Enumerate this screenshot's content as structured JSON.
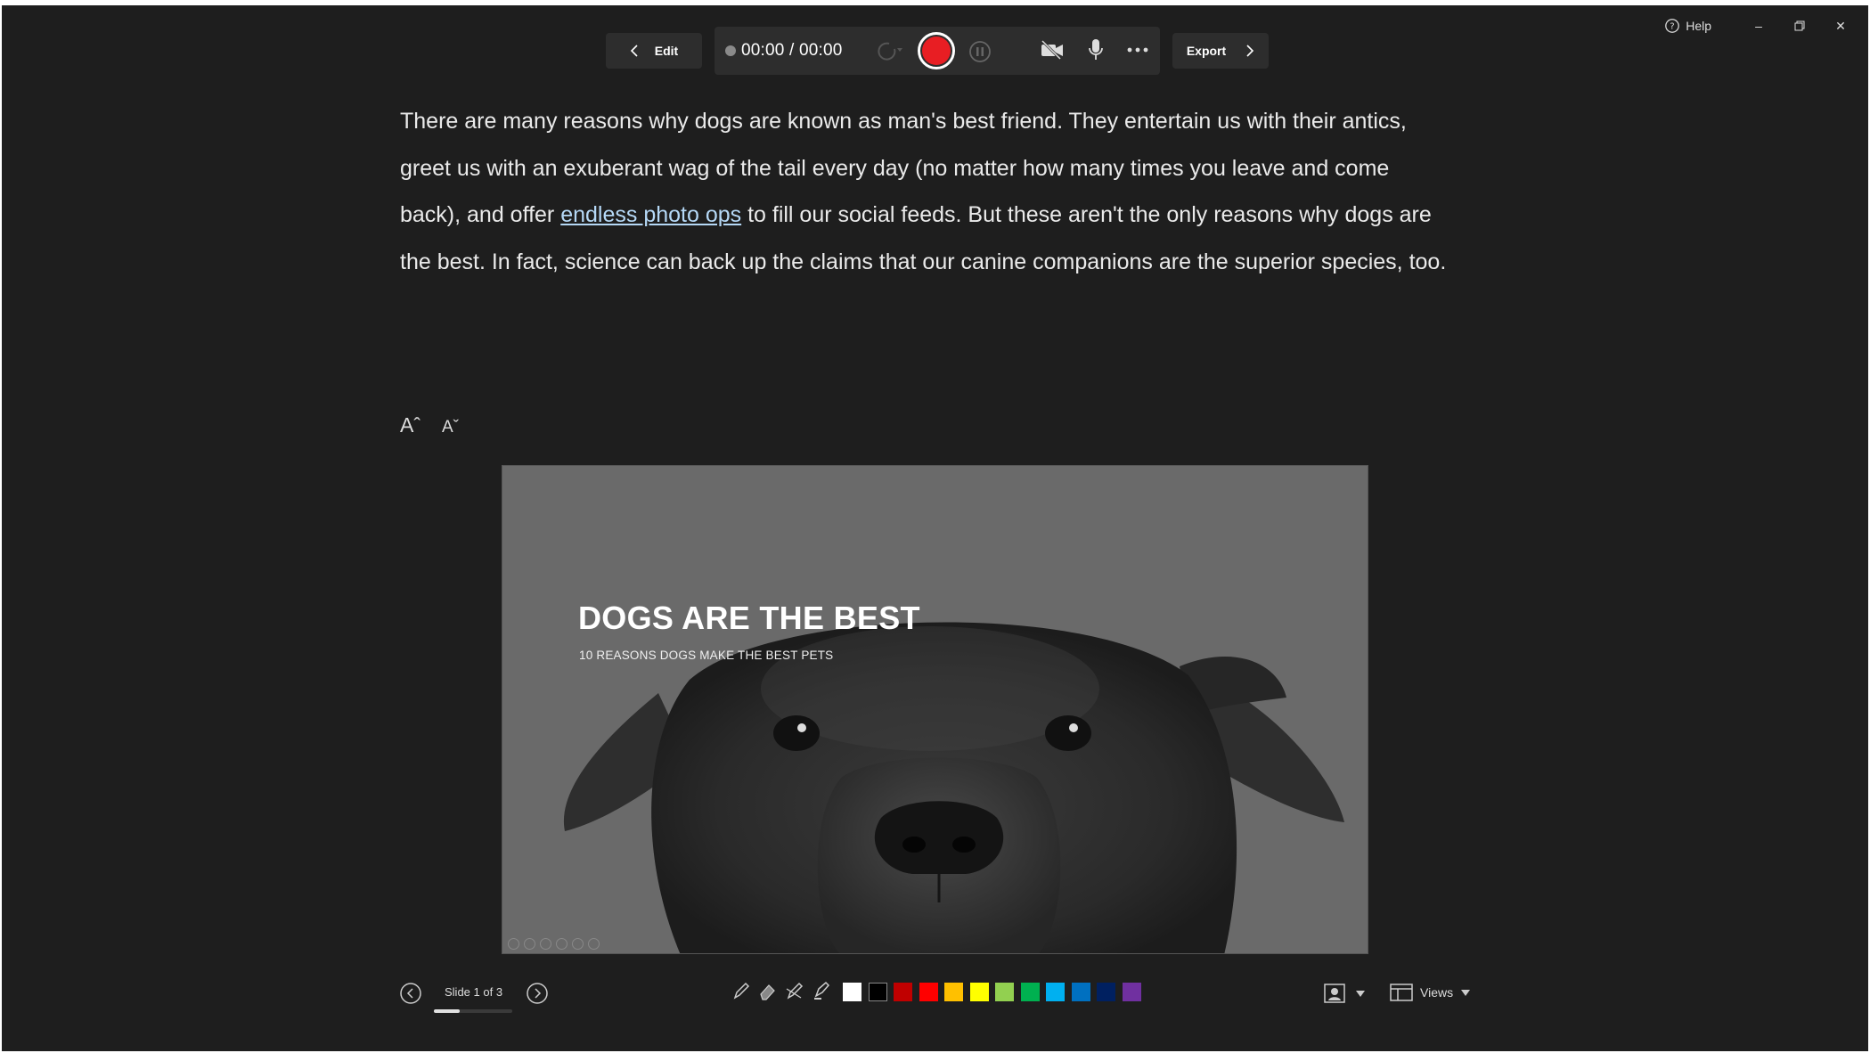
{
  "window": {
    "help_label": "Help",
    "minimize": "–",
    "restore": "🗗",
    "close": "✕"
  },
  "toolbar": {
    "edit_label": "Edit",
    "timer": "00:00 / 00:00",
    "export_label": "Export",
    "record_color": "#e81e23"
  },
  "notes": {
    "before_link": "There are many reasons why dogs are known as man's best friend. They entertain us with their antics, greet us with an exuberant wag of the tail every day (no matter how many times you leave and come back), and offer ",
    "link_text": "endless photo ops",
    "after_link": " to fill our social feeds. But these aren't the only reasons why dogs are the best. In fact, science can back up the claims that our canine companions are the superior species, too."
  },
  "font_controls": {
    "increase": "Aˆ",
    "decrease": "Aˇ"
  },
  "slide": {
    "title": "DOGS ARE THE BEST",
    "subtitle": "10 REASONS DOGS MAKE THE BEST PETS"
  },
  "navigation": {
    "slide_counter": "Slide 1 of 3",
    "progress_fraction": 0.333
  },
  "ink": {
    "tools": [
      "pen-icon",
      "eraser-icon",
      "pen-erase-icon",
      "highlighter-icon"
    ],
    "colors": [
      "#ffffff",
      "#000000",
      "#c00000",
      "#ff0000",
      "#ffc000",
      "#ffff00",
      "#92d050",
      "#00b050",
      "#00b0f0",
      "#0070c0",
      "#002060",
      "#7030a0"
    ]
  },
  "views": {
    "label": "Views"
  }
}
